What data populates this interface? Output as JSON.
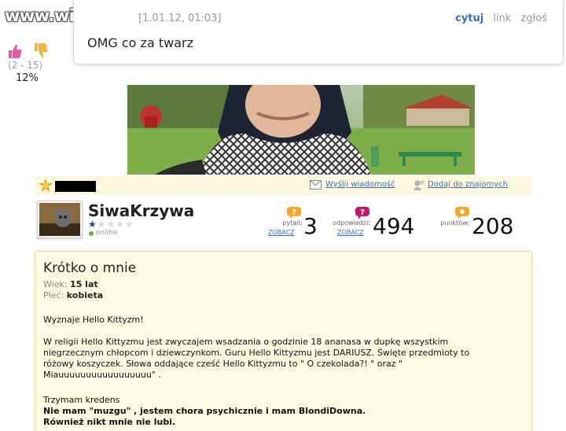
{
  "watermark": "www.wiocha.pl",
  "comment": {
    "meta": "[1.01.12, 01:03]",
    "actions": [
      "cytuj",
      "link",
      "zgłoś"
    ],
    "text": "OMG co za twarz",
    "votes": "(2 - 15)",
    "percent": "12%"
  },
  "strip": {
    "send_message": "Wyślij wiadomość",
    "add_friend": "Dodaj do znajomych"
  },
  "profile": {
    "username": "SiwaKrzywa",
    "rating_stars": 1,
    "rating_max": 5,
    "status": "online",
    "stats": [
      {
        "label": "pytań:",
        "link": "ZOBACZ",
        "value": "3"
      },
      {
        "label": "odpowiedzi:",
        "link": "ZOBACZ",
        "value": "494"
      },
      {
        "label": "punktów:",
        "link": "",
        "value": "208"
      }
    ]
  },
  "about": {
    "title": "Krótko o mnie",
    "age_label": "Wiek:",
    "age_value": "15 lat",
    "gender_label": "Płeć:",
    "gender_value": "kobieta",
    "p1": "Wyznaje Hello Kittyzm!",
    "p2_l1": "W religii Hello Kittyzmu jest zwyczajem wsadzania o godzinie 18 ananasa w dupkę wszystkim",
    "p2_l2": "niegrzecznym chłopcom i dziewczynkom. Guru Hello Kittyzmu jest DARIUSZ. Święte przedmioty to",
    "p2_l3": "różowy koszyczek. Słowa oddające cześć Hello Kittyzmu to \" O czekolada?! \" oraz \"",
    "p2_l4": "Miauuuuuuuuuuuuuuuuu\" .",
    "p3_l1": "Trzymam kredens",
    "p3_l2": "Nie mam \"muzgu\" , jestem chora psychicznie i mam BlondiDowna.",
    "p3_l3": "Również nikt mnie nie lubi."
  },
  "colors": {
    "link": "#3a6fbf",
    "about_bg": "#fefbe3",
    "strip_bg": "#fdf9df",
    "stat_orange": "#f5a623",
    "stat_magenta": "#c2186c"
  }
}
